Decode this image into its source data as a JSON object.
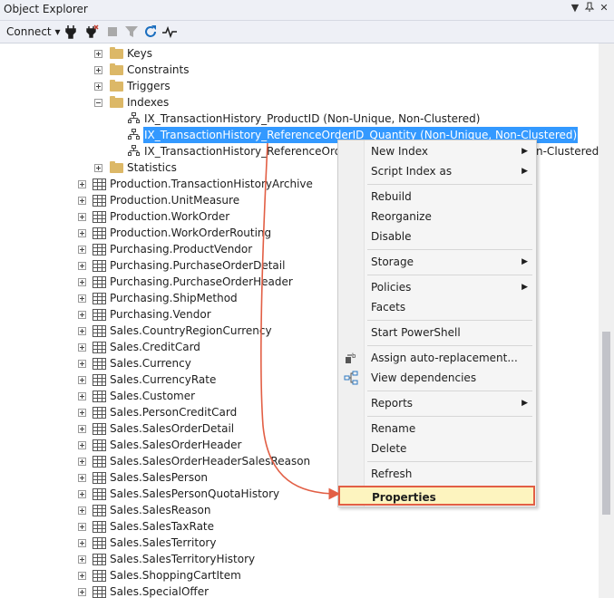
{
  "window": {
    "title": "Object Explorer",
    "dropdown_glyph": "▼",
    "pin_glyph": "📌",
    "close_glyph": "✕"
  },
  "toolbar": {
    "connect_label": "Connect",
    "connect_caret": "▾"
  },
  "tree": {
    "folders": [
      {
        "label": "Keys",
        "state": "collapsed"
      },
      {
        "label": "Constraints",
        "state": "collapsed"
      },
      {
        "label": "Triggers",
        "state": "collapsed"
      },
      {
        "label": "Indexes",
        "state": "expanded"
      }
    ],
    "indexes": [
      {
        "label": "IX_TransactionHistory_ProductID (Non-Unique, Non-Clustered)"
      },
      {
        "label": "IX_TransactionHistory_ReferenceOrderID_Quantity (Non-Unique, Non-Clustered)",
        "selected": true
      },
      {
        "label": "IX_TransactionHistory_ReferenceOrderID_",
        "tail": "n-Clustered)"
      }
    ],
    "statistics_label": "Statistics",
    "tables": [
      "Production.TransactionHistoryArchive",
      "Production.UnitMeasure",
      "Production.WorkOrder",
      "Production.WorkOrderRouting",
      "Purchasing.ProductVendor",
      "Purchasing.PurchaseOrderDetail",
      "Purchasing.PurchaseOrderHeader",
      "Purchasing.ShipMethod",
      "Purchasing.Vendor",
      "Sales.CountryRegionCurrency",
      "Sales.CreditCard",
      "Sales.Currency",
      "Sales.CurrencyRate",
      "Sales.Customer",
      "Sales.PersonCreditCard",
      "Sales.SalesOrderDetail",
      "Sales.SalesOrderHeader",
      "Sales.SalesOrderHeaderSalesReason",
      "Sales.SalesPerson",
      "Sales.SalesPersonQuotaHistory",
      "Sales.SalesReason",
      "Sales.SalesTaxRate",
      "Sales.SalesTerritory",
      "Sales.SalesTerritoryHistory",
      "Sales.ShoppingCartItem",
      "Sales.SpecialOffer"
    ]
  },
  "context_menu": {
    "submenu_glyph": "▶",
    "items": [
      {
        "label": "New Index",
        "submenu": true
      },
      {
        "label": "Script Index as",
        "submenu": true
      },
      {
        "label": "Rebuild"
      },
      {
        "label": "Reorganize"
      },
      {
        "label": "Disable"
      },
      {
        "label": "Storage",
        "submenu": true
      },
      {
        "label": "Policies",
        "submenu": true
      },
      {
        "label": "Facets"
      },
      {
        "label": "Start PowerShell"
      },
      {
        "label": "Assign auto-replacement...",
        "icon": "auto-replace-icon"
      },
      {
        "label": "View dependencies",
        "icon": "dependencies-icon"
      },
      {
        "label": "Reports",
        "submenu": true
      },
      {
        "label": "Rename"
      },
      {
        "label": "Delete"
      },
      {
        "label": "Refresh"
      },
      {
        "label": "Properties",
        "highlighted": true
      }
    ]
  },
  "colors": {
    "selection": "#3399ff",
    "annotation_arrow": "#e25f45",
    "highlight_fill": "#fdf4bf"
  }
}
